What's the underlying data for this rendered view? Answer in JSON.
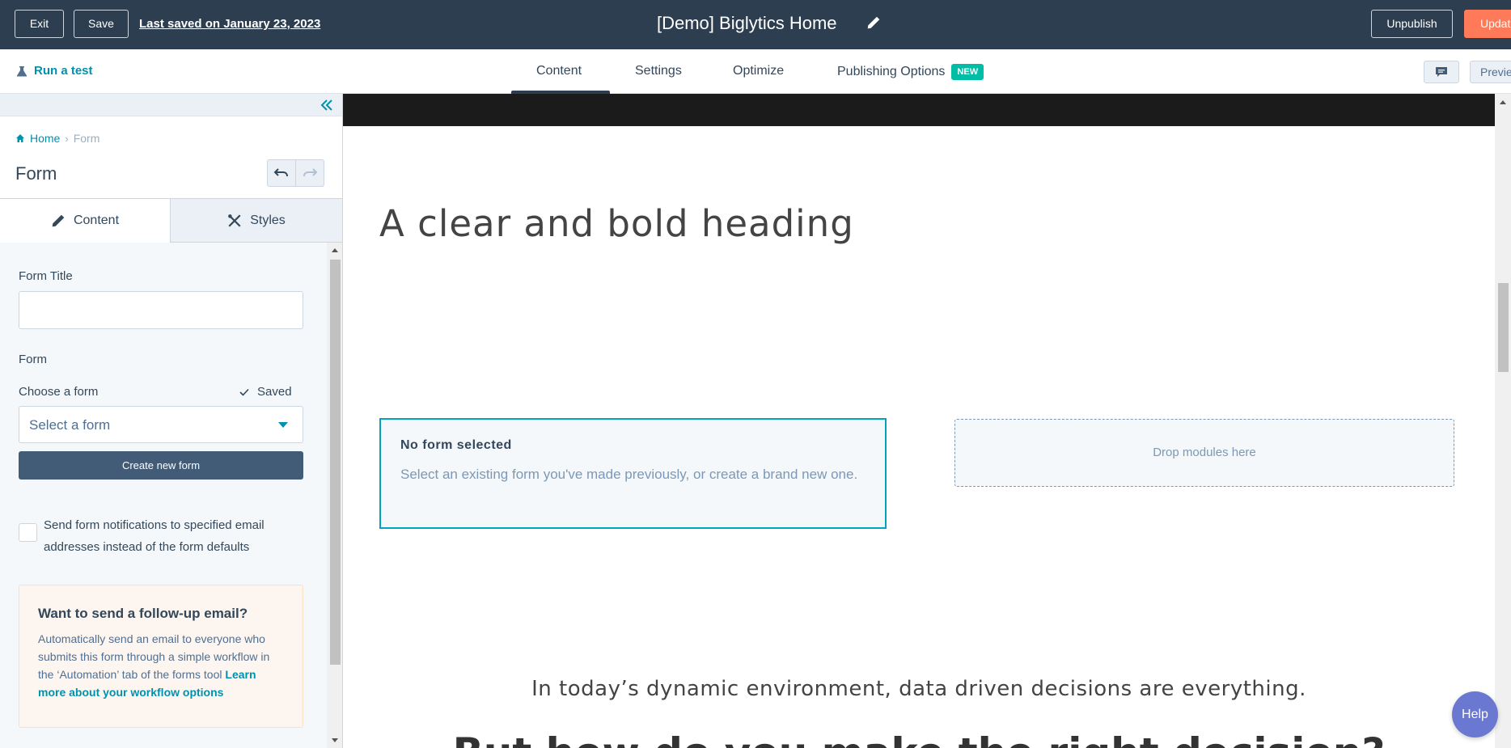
{
  "topbar": {
    "exit_label": "Exit",
    "save_label": "Save",
    "last_saved": "Last saved on January 23, 2023",
    "page_title": "[Demo] Biglytics Home",
    "unpublish_label": "Unpublish",
    "update_label": "Update"
  },
  "subbar": {
    "run_test_label": "Run a test",
    "tabs": [
      {
        "label": "Content",
        "active": true
      },
      {
        "label": "Settings"
      },
      {
        "label": "Optimize"
      },
      {
        "label": "Publishing Options"
      }
    ],
    "new_badge": "NEW",
    "preview_label": "Preview"
  },
  "panel": {
    "breadcrumb_home": "Home",
    "breadcrumb_separator": "›",
    "breadcrumb_current": "Form",
    "title": "Form",
    "tabs": {
      "content": "Content",
      "styles": "Styles"
    },
    "form_title_label": "Form Title",
    "form_title_value": "",
    "form_section_label": "Form",
    "choose_form_label": "Choose a form",
    "saved_status": "Saved",
    "select_form_value": "Select a form",
    "create_form_label": "Create new form",
    "notifications_label": "Send form notifications to specified email addresses instead of the form defaults",
    "notifications_checked": false,
    "followup": {
      "title": "Want to send a follow-up email?",
      "text": "Automatically send an email to everyone who submits this form through a simple workflow in the ‘Automation’ tab of the forms tool",
      "link": "Learn more about your workflow options"
    }
  },
  "canvas": {
    "heading": "A clear and bold heading",
    "no_form_title": "No form selected",
    "no_form_text": "Select an existing form you've made previously, or create a brand new one.",
    "drop_zone": "Drop modules here",
    "tagline": "In today’s dynamic environment, data driven decisions are everything.",
    "bottom_heading": "But how do you make the right decision?"
  },
  "help_label": "Help",
  "colors": {
    "topbar_bg": "#2d3e50",
    "accent": "#0091ae",
    "update_button": "#ff7a59",
    "new_badge": "#00bda5",
    "form_border": "#00a4bd",
    "help_button": "#6a78d1"
  }
}
